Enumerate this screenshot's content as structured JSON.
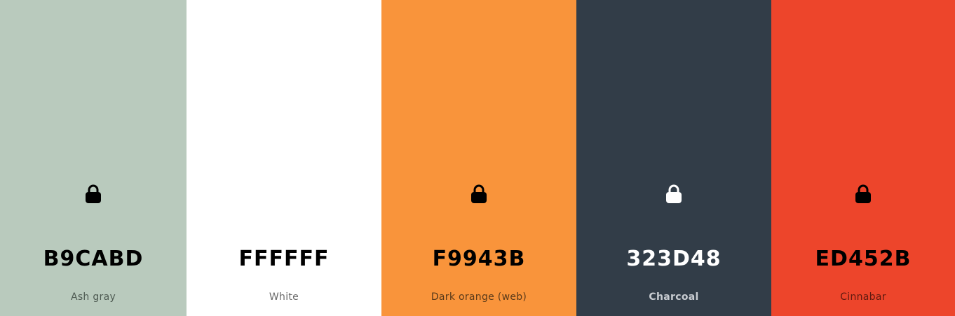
{
  "palette": {
    "swatches": [
      {
        "hex": "B9CABD",
        "name": "Ash gray",
        "background": "#B9CABD",
        "text_color": "#000000",
        "name_color": "#4E5A52",
        "lock_color": "#000000",
        "lock_visible": true,
        "lock_icon": "lock-icon"
      },
      {
        "hex": "FFFFFF",
        "name": "White",
        "background": "#FFFFFF",
        "text_color": "#000000",
        "name_color": "#6B6B6B",
        "lock_color": "#000000",
        "lock_visible": false,
        "lock_icon": "lock-icon"
      },
      {
        "hex": "F9943B",
        "name": "Dark orange (web)",
        "background": "#F9943B",
        "text_color": "#000000",
        "name_color": "#5A3A1A",
        "lock_color": "#000000",
        "lock_visible": true,
        "lock_icon": "lock-icon"
      },
      {
        "hex": "323D48",
        "name": "Charcoal",
        "background": "#323D48",
        "text_color": "#FFFFFF",
        "name_color": "#C9CDD2",
        "lock_color": "#FFFFFF",
        "lock_visible": true,
        "lock_icon": "lock-icon"
      },
      {
        "hex": "ED452B",
        "name": "Cinnabar",
        "background": "#ED452B",
        "text_color": "#000000",
        "name_color": "#5E1A10",
        "lock_color": "#000000",
        "lock_visible": true,
        "lock_icon": "lock-icon"
      }
    ]
  }
}
